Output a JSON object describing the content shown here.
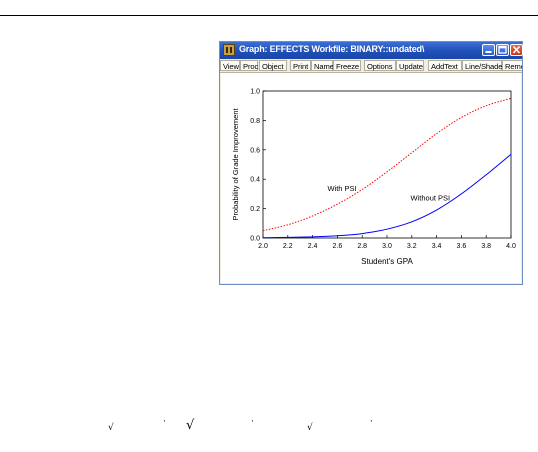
{
  "window": {
    "title": "Graph: EFFECTS   Workfile: BINARY::undated\\",
    "toolbar": [
      "View",
      "Proc",
      "Object",
      "Print",
      "Name",
      "Freeze",
      "Options",
      "Update",
      "AddText",
      "Line/Shade",
      "Remo"
    ]
  },
  "colors": {
    "with_psi": "#ff0000",
    "without_psi": "#0000ff",
    "titlebar": "#2458c7"
  },
  "chart_data": {
    "type": "line",
    "xlabel": "Student's GPA",
    "ylabel": "Probability of Grade Improvement",
    "xlim": [
      2.0,
      4.0
    ],
    "ylim": [
      0.0,
      1.0
    ],
    "x_ticks": [
      "2.0",
      "2.2",
      "2.4",
      "2.6",
      "2.8",
      "3.0",
      "3.2",
      "3.4",
      "3.6",
      "3.8",
      "4.0"
    ],
    "y_ticks": [
      "0.0",
      "0.2",
      "0.4",
      "0.6",
      "0.8",
      "1.0"
    ],
    "x": [
      2.0,
      2.2,
      2.4,
      2.6,
      2.8,
      3.0,
      3.2,
      3.4,
      3.6,
      3.8,
      4.0
    ],
    "series": [
      {
        "name": "With PSI",
        "style": "dotted",
        "values": [
          0.05,
          0.09,
          0.15,
          0.23,
          0.33,
          0.45,
          0.58,
          0.71,
          0.82,
          0.9,
          0.95
        ]
      },
      {
        "name": "Without PSI",
        "style": "solid",
        "values": [
          0.002,
          0.004,
          0.008,
          0.015,
          0.03,
          0.06,
          0.11,
          0.19,
          0.3,
          0.43,
          0.57
        ]
      }
    ],
    "annotations": [
      "With PSI",
      "Without PSI"
    ]
  },
  "formula_fragments": [
    "√",
    "·",
    "√",
    "·",
    "√",
    "·"
  ]
}
